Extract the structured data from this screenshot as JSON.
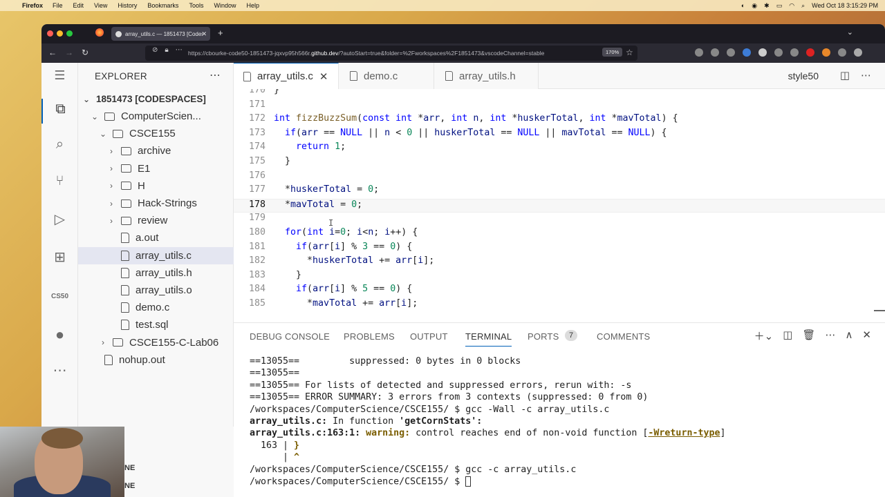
{
  "menubar": {
    "app": "Firefox",
    "items": [
      "File",
      "Edit",
      "View",
      "History",
      "Bookmarks",
      "Tools",
      "Window",
      "Help"
    ],
    "datetime": "Wed Oct 18  3:15:29 PM"
  },
  "browser": {
    "tab_title": "array_utils.c — 1851473 [Codes",
    "url_prefix": "https://cbourke-code50-1851473-jqxvp95h566r.",
    "url_domain": "github.dev",
    "url_suffix": "/?autoStart=true&folder=%2Fworkspaces%2F1851473&vscodeChannel=stable",
    "zoom": "170%"
  },
  "explorer": {
    "title": "EXPLORER",
    "root": "1851473 [CODESPACES]",
    "items": [
      {
        "label": "ComputerScien...",
        "kind": "folder",
        "open": true,
        "depth": 1
      },
      {
        "label": "CSCE155",
        "kind": "folder",
        "open": true,
        "depth": 2
      },
      {
        "label": "archive",
        "kind": "folder",
        "open": false,
        "depth": 3
      },
      {
        "label": "E1",
        "kind": "folder",
        "open": false,
        "depth": 3
      },
      {
        "label": "H",
        "kind": "folder",
        "open": false,
        "depth": 3
      },
      {
        "label": "Hack-Strings",
        "kind": "folder",
        "open": false,
        "depth": 3
      },
      {
        "label": "review",
        "kind": "folder",
        "open": false,
        "depth": 3
      },
      {
        "label": "a.out",
        "kind": "file",
        "depth": 3
      },
      {
        "label": "array_utils.c",
        "kind": "file",
        "depth": 3,
        "selected": true
      },
      {
        "label": "array_utils.h",
        "kind": "file",
        "depth": 3
      },
      {
        "label": "array_utils.o",
        "kind": "file",
        "depth": 3
      },
      {
        "label": "demo.c",
        "kind": "file",
        "depth": 3
      },
      {
        "label": "test.sql",
        "kind": "file",
        "depth": 3
      },
      {
        "label": "CSCE155-C-Lab06",
        "kind": "folder",
        "open": false,
        "depth": 2
      },
      {
        "label": "nohup.out",
        "kind": "file",
        "depth": 1
      }
    ]
  },
  "editor": {
    "tabs": [
      {
        "label": "array_utils.c",
        "active": true
      },
      {
        "label": "demo.c",
        "active": false
      },
      {
        "label": "array_utils.h",
        "active": false
      }
    ],
    "right_label": "style50",
    "current_line": 178,
    "lines": [
      {
        "n": "170",
        "t": "}"
      },
      {
        "n": "171",
        "t": ""
      },
      {
        "n": "172",
        "t": "int fizzBuzzSum(const int *arr, int n, int *huskerTotal, int *mavTotal) {"
      },
      {
        "n": "173",
        "t": "  if(arr == NULL || n < 0 || huskerTotal == NULL || mavTotal == NULL) {"
      },
      {
        "n": "174",
        "t": "    return 1;"
      },
      {
        "n": "175",
        "t": "  }"
      },
      {
        "n": "176",
        "t": ""
      },
      {
        "n": "177",
        "t": "  *huskerTotal = 0;"
      },
      {
        "n": "178",
        "t": "  *mavTotal = 0;"
      },
      {
        "n": "179",
        "t": ""
      },
      {
        "n": "180",
        "t": "  for(int i=0; i<n; i++) {"
      },
      {
        "n": "181",
        "t": "    if(arr[i] % 3 == 0) {"
      },
      {
        "n": "182",
        "t": "      *huskerTotal += arr[i];"
      },
      {
        "n": "183",
        "t": "    }"
      },
      {
        "n": "184",
        "t": "    if(arr[i] % 5 == 0) {"
      },
      {
        "n": "185",
        "t": "      *mavTotal += arr[i];"
      }
    ]
  },
  "panel": {
    "tabs": [
      "DEBUG CONSOLE",
      "PROBLEMS",
      "OUTPUT",
      "TERMINAL",
      "PORTS",
      "COMMENTS"
    ],
    "active": "TERMINAL",
    "ports_count": "7",
    "terminal": [
      "==13055==         suppressed: 0 bytes in 0 blocks",
      "==13055==",
      "==13055== For lists of detected and suppressed errors, rerun with: -s",
      "==13055== ERROR SUMMARY: 3 errors from 3 contexts (suppressed: 0 from 0)",
      "/workspaces/ComputerScience/CSCE155/ $ gcc -Wall -c array_utils.c",
      "array_utils.c: In function 'getCornStats':",
      "array_utils.c:163:1: warning: control reaches end of non-void function [-Wreturn-type]",
      "  163 | }",
      "      | ^",
      "/workspaces/ComputerScience/CSCE155/ $ gcc -c array_utils.c",
      "/workspaces/ComputerScience/CSCE155/ $ "
    ]
  },
  "webcam_side": {
    "line1": "NE",
    "line2": "NE"
  },
  "colors": {
    "accent": "#005fb8",
    "keyword": "#0000ff",
    "function": "#795e26",
    "param": "#001080",
    "number": "#098658",
    "warning": "#7a5d00"
  }
}
